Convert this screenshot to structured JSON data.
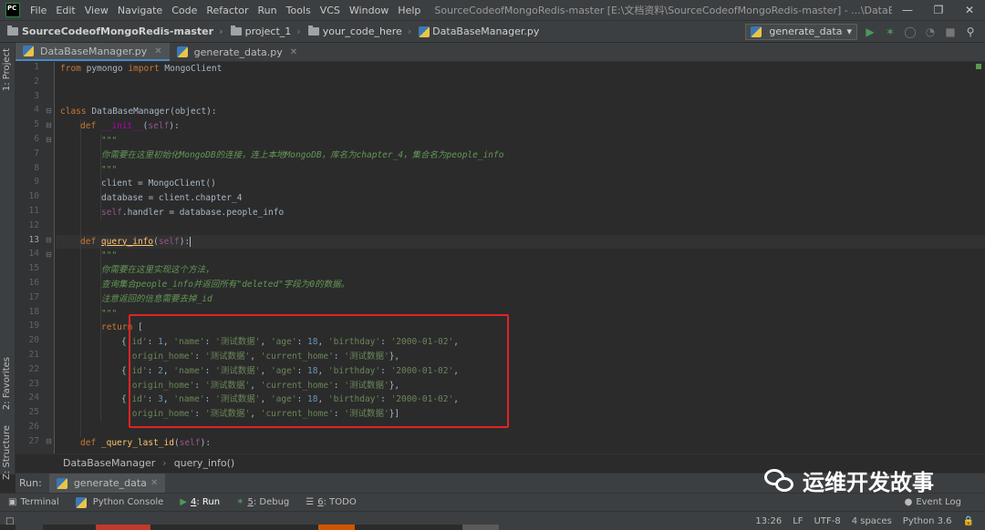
{
  "titlebar": {
    "menus": [
      "File",
      "Edit",
      "View",
      "Navigate",
      "Code",
      "Refactor",
      "Run",
      "Tools",
      "VCS",
      "Window",
      "Help"
    ],
    "window_title": "SourceCodeofMongoRedis-master [E:\\文档资料\\SourceCodeofMongoRedis-master] - ...\\DataBaseManager.py",
    "logo_text": "PC"
  },
  "navbar": {
    "project": "SourceCodeofMongoRedis-master",
    "folder1": "project_1",
    "folder2": "your_code_here",
    "file": "DataBaseManager.py",
    "run_config": "generate_data"
  },
  "left_strip": {
    "project": "1: Project",
    "favorites": "2: Favorites",
    "structure": "Z: Structure"
  },
  "tabs": [
    {
      "label": "DataBaseManager.py",
      "active": true
    },
    {
      "label": "generate_data.py",
      "active": false
    }
  ],
  "editor": {
    "current_line": 13,
    "line_numbers": [
      "1",
      "2",
      "3",
      "4",
      "5",
      "6",
      "7",
      "8",
      "9",
      "10",
      "11",
      "12",
      "13",
      "14",
      "15",
      "16",
      "17",
      "18",
      "19",
      "20",
      "21",
      "22",
      "23",
      "24",
      "25",
      "26",
      "27"
    ],
    "tokens": {
      "l1_kw1": "from",
      "l1_mod": " pymongo ",
      "l1_kw2": "import",
      "l1_rest": " MongoClient",
      "l4_kw": "class",
      "l4_rest": " DataBaseManager(object):",
      "l5_kw": "def",
      "l5_name": "__init__",
      "l5_p1": "(",
      "l5_self": "self",
      "l5_p2": "):",
      "l6_doc": "\"\"\"",
      "l7_doc": "你需要在这里初始化MongoDB的连接，连上本地MongoDB，库名为chapter_4，集合名为people_info",
      "l8_doc": "\"\"\"",
      "l9_code": "client = MongoClient()",
      "l10_code": "database = client.chapter_4",
      "l11_self": "self",
      "l11_rest": ".handler = database.people_info",
      "l13_kw": "def",
      "l13_name": "query_info",
      "l13_p1": "(",
      "l13_self": "self",
      "l13_p2": "):",
      "l14_doc": "\"\"\"",
      "l15_doc": "你需要在这里实现这个方法，",
      "l16_doc": "查询集合people_info并返回所有\"deleted\"字段为0的数据。",
      "l17_doc": "注意返回的信息需要去掉_id",
      "l18_doc": "\"\"\"",
      "l19_kw": "return",
      "l19_rest": " [",
      "l20_a": "{",
      "l20_k1": "'id'",
      "l20_b": ": ",
      "l20_v1": "1",
      "l20_c": ", ",
      "l20_k2": "'name'",
      "l20_d": ": ",
      "l20_v2": "'测试数据'",
      "l20_e": ", ",
      "l20_k3": "'age'",
      "l20_f": ": ",
      "l20_v3": "18",
      "l20_g": ", ",
      "l20_k4": "'birthday'",
      "l20_h": ": ",
      "l20_v4": "'2000-01-02'",
      "l20_i": ",",
      "l21_k1": "'origin_home'",
      "l21_a": ": ",
      "l21_v1": "'测试数据'",
      "l21_b": ", ",
      "l21_k2": "'current_home'",
      "l21_c": ": ",
      "l21_v2": "'测试数据'",
      "l21_d": "},",
      "l22_a": "{",
      "l22_k1": "'id'",
      "l22_b": ": ",
      "l22_v1": "2",
      "l22_c": ", ",
      "l22_k2": "'name'",
      "l22_d": ": ",
      "l22_v2": "'测试数据'",
      "l22_e": ", ",
      "l22_k3": "'age'",
      "l22_f": ": ",
      "l22_v3": "18",
      "l22_g": ", ",
      "l22_k4": "'birthday'",
      "l22_h": ": ",
      "l22_v4": "'2000-01-02'",
      "l22_i": ",",
      "l23_k1": "'origin_home'",
      "l23_a": ": ",
      "l23_v1": "'测试数据'",
      "l23_b": ", ",
      "l23_k2": "'current_home'",
      "l23_c": ": ",
      "l23_v2": "'测试数据'",
      "l23_d": "},",
      "l24_a": "{",
      "l24_k1": "'id'",
      "l24_b": ": ",
      "l24_v1": "3",
      "l24_c": ", ",
      "l24_k2": "'name'",
      "l24_d": ": ",
      "l24_v2": "'测试数据'",
      "l24_e": ", ",
      "l24_k3": "'age'",
      "l24_f": ": ",
      "l24_v3": "18",
      "l24_g": ", ",
      "l24_k4": "'birthday'",
      "l24_h": ": ",
      "l24_v4": "'2000-01-02'",
      "l24_i": ",",
      "l25_k1": "'origin_home'",
      "l25_a": ": ",
      "l25_v1": "'测试数据'",
      "l25_b": ", ",
      "l25_k2": "'current_home'",
      "l25_c": ": ",
      "l25_v2": "'测试数据'",
      "l25_d": "}]",
      "l27_kw": "def",
      "l27_name": " _query_last_id",
      "l27_p1": "(",
      "l27_self": "self",
      "l27_p2": "):"
    }
  },
  "breadcrumb": {
    "class": "DataBaseManager",
    "method": "query_info()"
  },
  "run_panel": {
    "label": "Run:",
    "tab": "generate_data"
  },
  "watermark": "运维开发故事",
  "bottom_tabs": {
    "terminal": "Terminal",
    "python_console": "Python Console",
    "run_num": "4",
    "run": ": Run",
    "debug_num": "5",
    "debug": ": Debug",
    "todo_num": "6",
    "todo": ": TODO",
    "event_log": "Event Log"
  },
  "statusbar": {
    "position": "13:26",
    "line_sep": "LF",
    "encoding": "UTF-8",
    "indent": "4 spaces",
    "interpreter": "Python 3.6"
  },
  "colors": {
    "keyword": "#cc7832",
    "function": "#ffc66d",
    "string": "#6a8759",
    "number": "#6897bb",
    "docstring": "#629755",
    "highlight_box": "#e02424"
  }
}
